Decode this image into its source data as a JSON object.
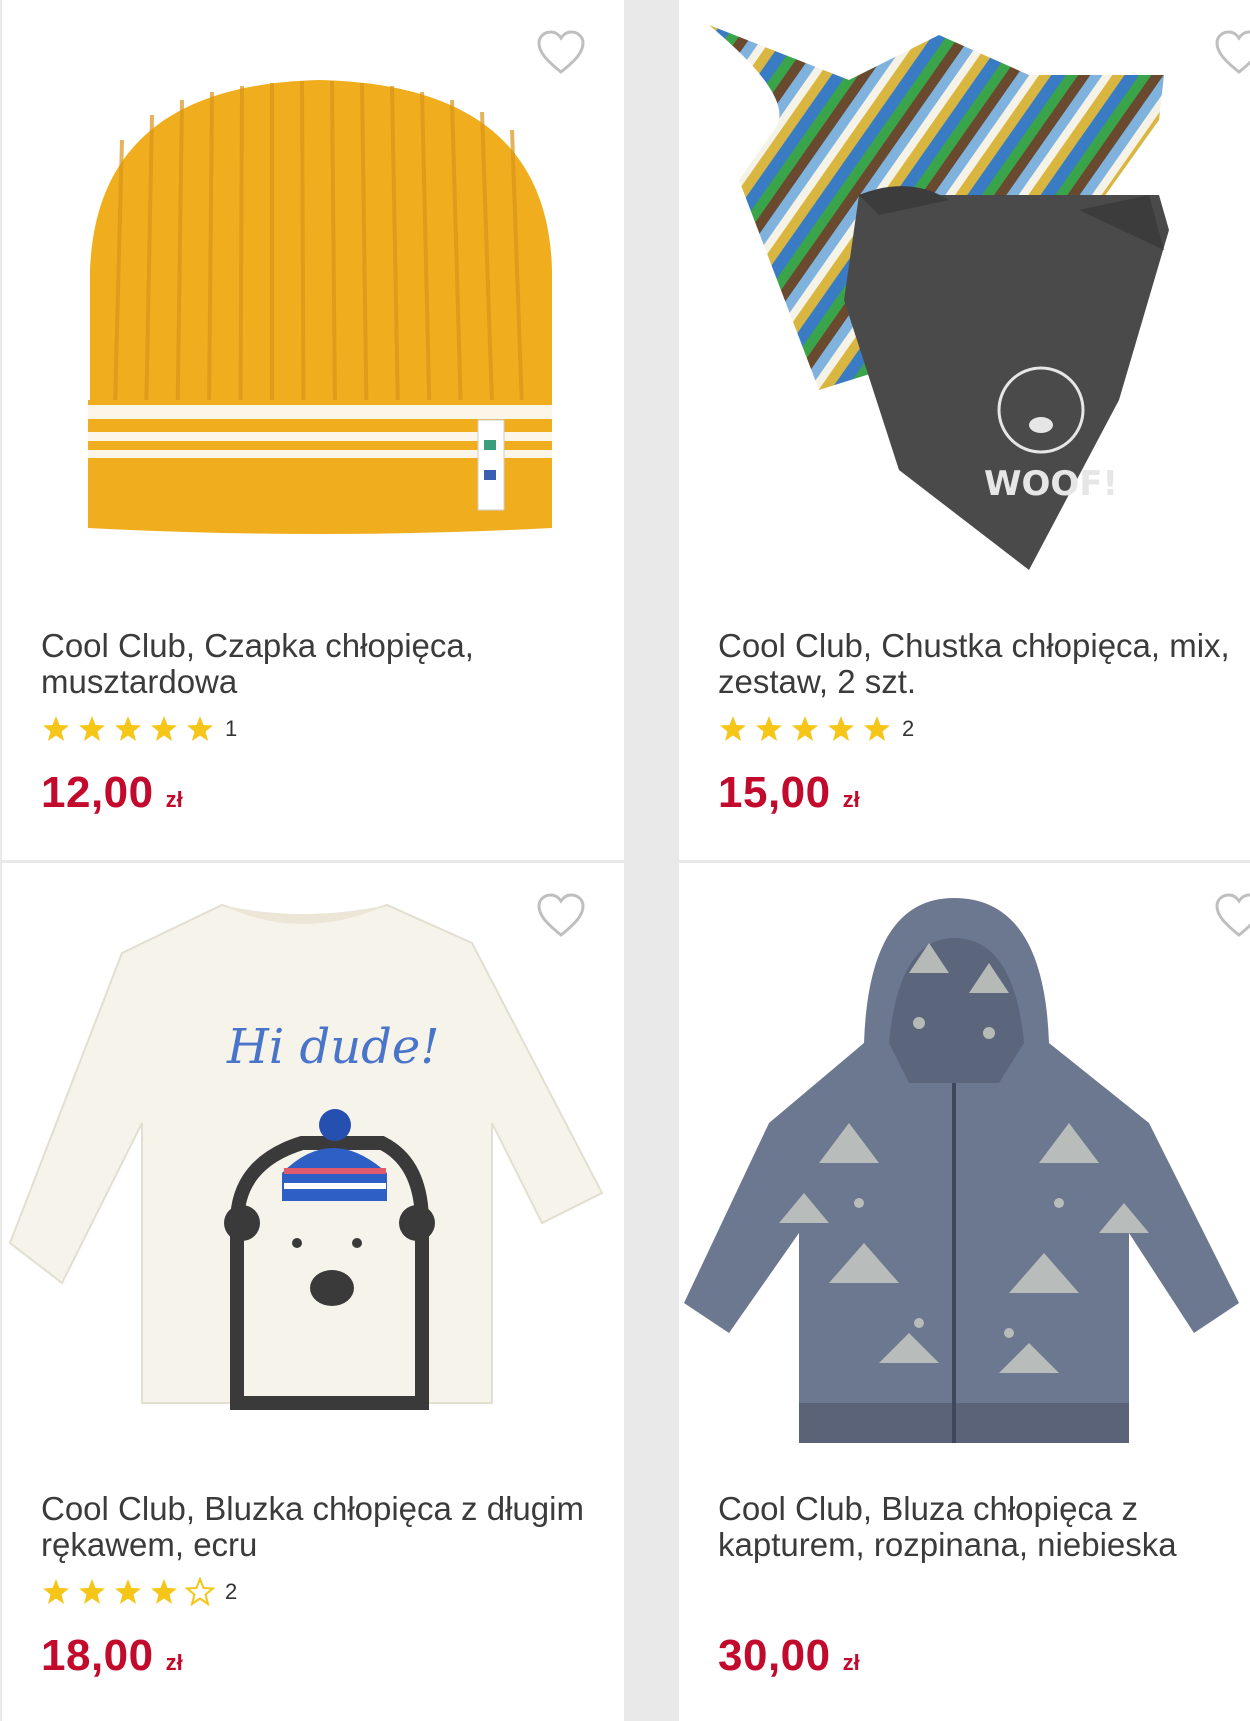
{
  "colors": {
    "price": "#c10a2c",
    "star": "#f5c518",
    "background": "#e9e9e9",
    "card": "#ffffff"
  },
  "products": [
    {
      "title": "Cool Club, Czapka chłopięca, musztardowa",
      "rating": 5,
      "rating_count": "1",
      "price": "12,00",
      "currency": "zł",
      "favorite_icon": "heart-outline-icon",
      "image": "mustard-beanie"
    },
    {
      "title": "Cool Club, Chustka chłopięca, mix, zestaw, 2 szt.",
      "rating": 5,
      "rating_count": "2",
      "price": "15,00",
      "currency": "zł",
      "favorite_icon": "heart-outline-icon",
      "image": "bandana-set",
      "image_text": "WOOF!"
    },
    {
      "title": "Cool Club, Bluzka chłopięca z długim rękawem, ecru",
      "rating": 4,
      "rating_count": "2",
      "price": "18,00",
      "currency": "zł",
      "favorite_icon": "heart-outline-icon",
      "image": "ecru-longsleeve",
      "image_text": "Hi dude!"
    },
    {
      "title": "Cool Club, Bluza chłopięca z kapturem, rozpinana, niebieska",
      "rating": 0,
      "rating_count": "",
      "price": "30,00",
      "currency": "zł",
      "favorite_icon": "heart-outline-icon",
      "image": "blue-hoodie"
    }
  ]
}
